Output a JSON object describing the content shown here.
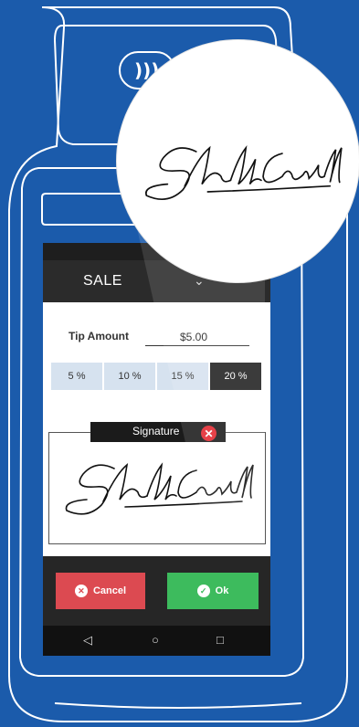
{
  "device": {
    "contactless_icon": "contactless-icon"
  },
  "header": {
    "title": "SALE",
    "chevron_icon": "chevron-down-icon"
  },
  "tip": {
    "label": "Tip Amount",
    "value": "$5.00",
    "options": [
      {
        "label": "5 %",
        "selected": false
      },
      {
        "label": "10 %",
        "selected": false
      },
      {
        "label": "15 %",
        "selected": false
      },
      {
        "label": "20 %",
        "selected": true
      }
    ]
  },
  "signature": {
    "label": "Signature",
    "close_icon": "close-icon",
    "signer": "Shelly Caudill"
  },
  "actions": {
    "cancel_label": "Cancel",
    "ok_label": "Ok"
  },
  "navigation": {
    "back_icon": "back-icon",
    "home_icon": "home-icon",
    "recents_icon": "recents-icon"
  },
  "colors": {
    "background": "#1b5bab",
    "cancel": "#dc4a51",
    "ok": "#3dbb5d",
    "close": "#e3272f",
    "selected_tip": "#202020"
  }
}
